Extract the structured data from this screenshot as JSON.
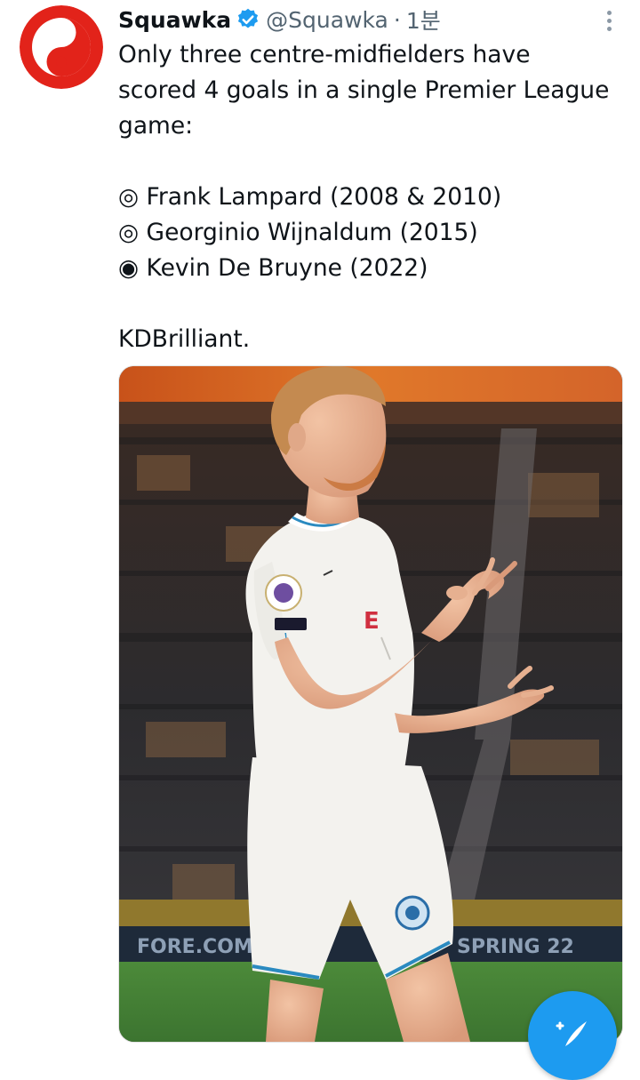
{
  "author": {
    "name": "Squawka",
    "handle": "@Squawka",
    "separator": "·",
    "time": "1분",
    "brand_color": "#e2231a",
    "verified_color": "#1d9bf0"
  },
  "tweet": {
    "lines": [
      "Only three centre-midfielders have",
      "scored 4 goals in a single Premier League",
      "game:",
      "",
      "◎ Frank Lampard (2008 & 2010)",
      "◎ Georginio Wijnaldum (2015)",
      "◉ Kevin De Bruyne (2022)",
      "",
      "KDBrilliant."
    ]
  },
  "icons": {
    "avatar": "squawka-logo-icon",
    "verified": "verified-badge-icon",
    "more": "more-options-icon",
    "compose": "compose-tweet-icon"
  },
  "media": {
    "alt_subject": "player-celebration-photo",
    "ad_board_texts": [
      "FORE.COM",
      "SPRING 22"
    ]
  },
  "accent_color": "#1d9bf0"
}
